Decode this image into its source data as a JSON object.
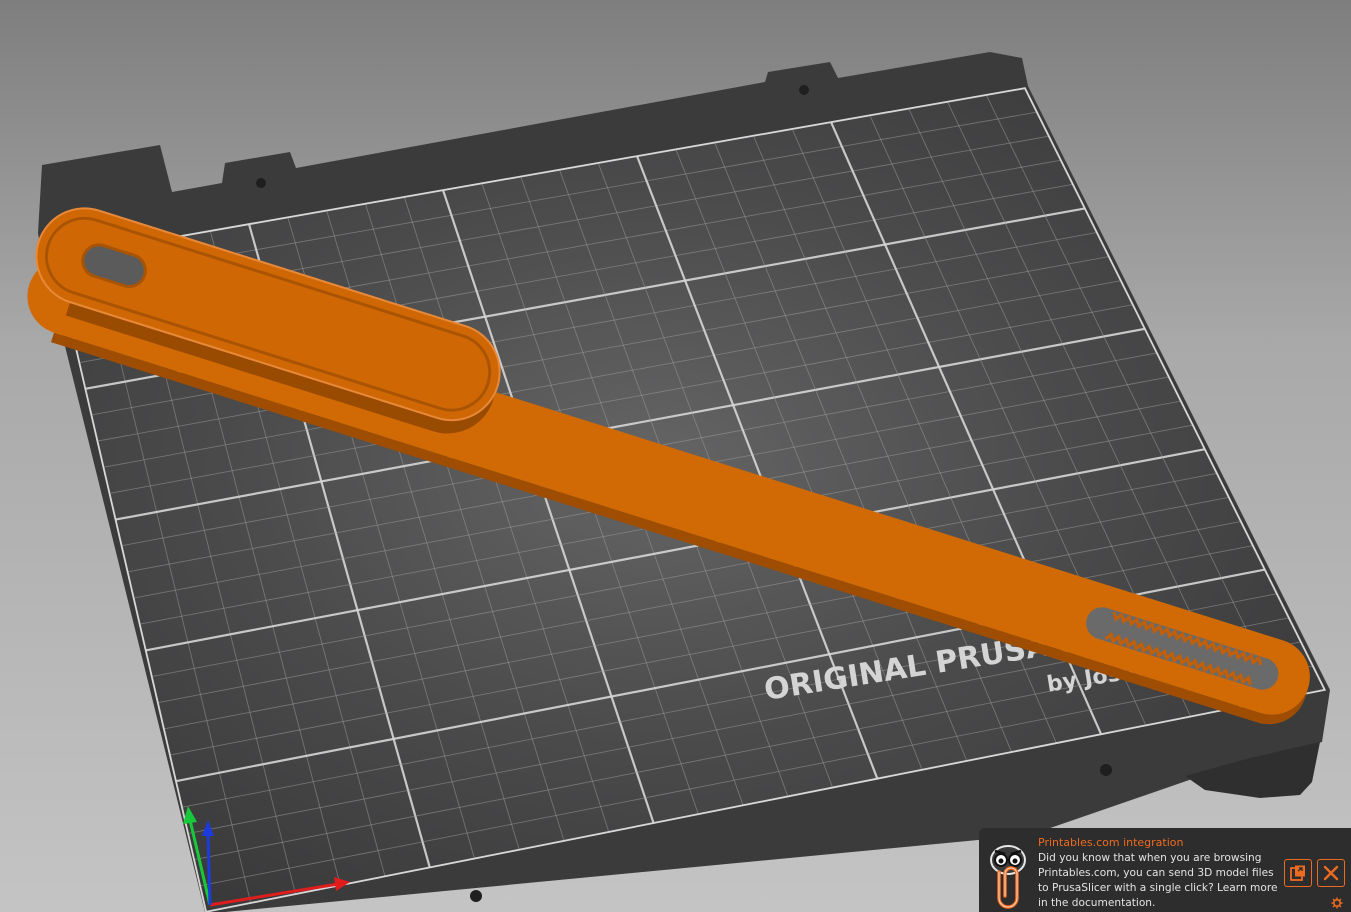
{
  "colors": {
    "background_top": "#7e7e7e",
    "bed_frame": "#3b3b3c",
    "bed_surface": "#3f3f40",
    "grid_line": "#9a9a9a",
    "model_orange": "#d26a05",
    "accent_orange": "#ed6b21",
    "axis_x": "#e01d1d",
    "axis_y": "#18c83a",
    "axis_z": "#1c3bde"
  },
  "bed": {
    "logo_line1": "ORIGINAL PRUSA i3 MK3",
    "logo_line2": "by Josef Prusa"
  },
  "notification": {
    "title": "Printables.com integration",
    "body": "Did you know that when you are browsing Printables.com, you can send 3D model files to PrusaSlicer with a single click? Learn more in the documentation.",
    "mascot_icon": "paperclip-mascot-icon",
    "open_icon": "open-document-icon",
    "close_icon": "close-icon",
    "settings_icon": "gear-icon"
  }
}
